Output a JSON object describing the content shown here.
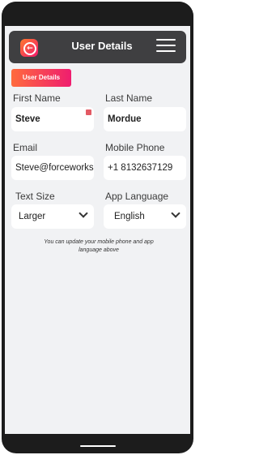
{
  "header": {
    "title": "User Details"
  },
  "section_tab": "User Details",
  "form": {
    "first_name": {
      "label": "First Name",
      "value": "Steve"
    },
    "last_name": {
      "label": "Last Name",
      "value": "Mordue"
    },
    "email": {
      "label": "Email",
      "value": "Steve@forceworks"
    },
    "mobile_phone": {
      "label": "Mobile Phone",
      "value": "+1 8132637129"
    },
    "text_size": {
      "label": "Text Size",
      "value": "Larger"
    },
    "app_language": {
      "label": "App Language",
      "value": "English"
    }
  },
  "hint": "You can update your mobile phone and app language above",
  "colors": {
    "accent_start": "#ff6b3d",
    "accent_end": "#ef1d6f",
    "header_bg": "#3f3f41"
  },
  "icons": {
    "logo": "back-arrow-icon",
    "menu": "hamburger-menu-icon",
    "select": "chevron-down-icon"
  }
}
